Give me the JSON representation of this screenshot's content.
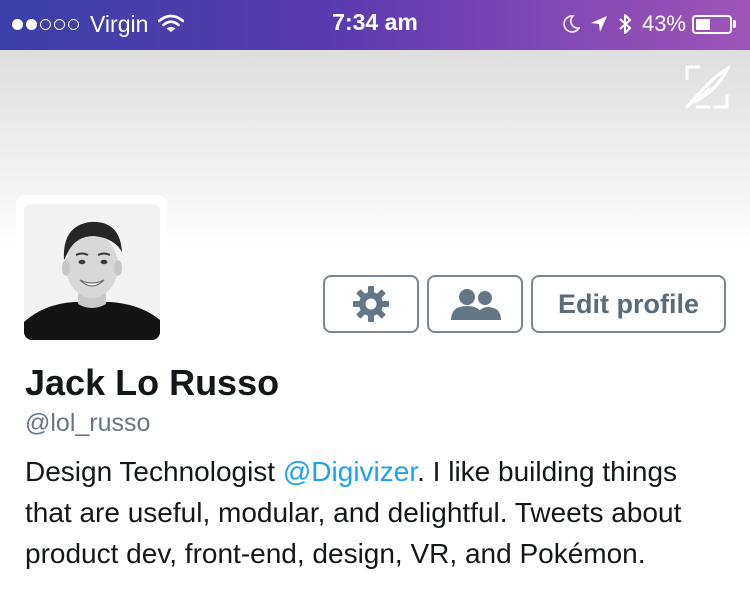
{
  "status_bar": {
    "carrier": "Virgin",
    "signal_bars_filled": 2,
    "signal_bars_total": 5,
    "time": "7:34 am",
    "battery_percent": "43%",
    "battery_level": 0.43,
    "icons": [
      "wifi-icon",
      "moon-icon",
      "location-arrow-icon",
      "bluetooth-icon",
      "battery-icon"
    ]
  },
  "header": {
    "compose_icon": "compose-tweet-icon"
  },
  "profile": {
    "name": "Jack Lo Russo",
    "handle": "@lol_russo",
    "bio_before": "Design Technologist ",
    "bio_mention": "@Digivizer",
    "bio_after": ". I like building things that are useful, modular, and delightful. Tweets about product dev, front-end, design, VR, and Pokémon."
  },
  "actions": {
    "settings_icon": "gear-icon",
    "people_icon": "people-icon",
    "edit_label": "Edit profile"
  },
  "colors": {
    "link": "#1da1f2",
    "secondary_text": "#657786",
    "status_gradient_start": "#3b3fa8",
    "status_gradient_end": "#9f55b8"
  }
}
